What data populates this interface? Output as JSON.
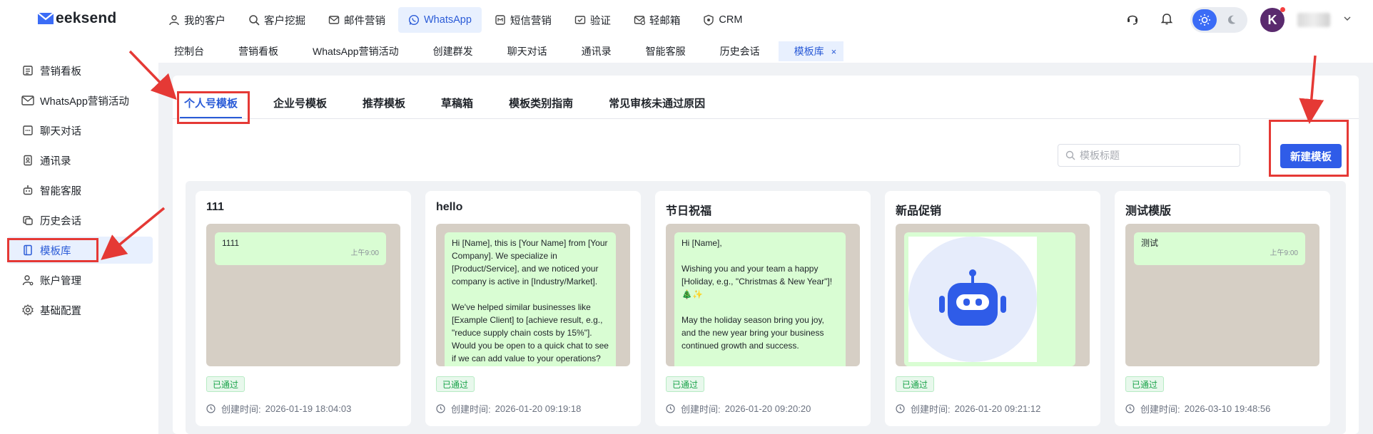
{
  "brand": {
    "logo_text": "eeksend"
  },
  "topnav": [
    {
      "label": "我的客户",
      "icon": "user-icon"
    },
    {
      "label": "客户挖掘",
      "icon": "search-icon"
    },
    {
      "label": "邮件营销",
      "icon": "mail-icon"
    },
    {
      "label": "WhatsApp",
      "icon": "whatsapp-icon",
      "active": true
    },
    {
      "label": "短信营销",
      "icon": "phone-icon"
    },
    {
      "label": "验证",
      "icon": "mail-check-icon"
    },
    {
      "label": "轻邮箱",
      "icon": "mail-light-icon"
    },
    {
      "label": "CRM",
      "icon": "crm-icon"
    }
  ],
  "user": {
    "avatar_letter": "K"
  },
  "subtabs": [
    {
      "label": "控制台"
    },
    {
      "label": "营销看板"
    },
    {
      "label": "WhatsApp营销活动"
    },
    {
      "label": "创建群发"
    },
    {
      "label": "聊天对话"
    },
    {
      "label": "通讯录"
    },
    {
      "label": "智能客服"
    },
    {
      "label": "历史会话"
    },
    {
      "label": "模板库",
      "active": true,
      "close": "×"
    }
  ],
  "sidebar": [
    {
      "label": "营销看板",
      "icon": "dashboard-icon"
    },
    {
      "label": "WhatsApp营销活动",
      "icon": "campaign-icon"
    },
    {
      "label": "聊天对话",
      "icon": "chat-icon"
    },
    {
      "label": "通讯录",
      "icon": "contacts-icon"
    },
    {
      "label": "智能客服",
      "icon": "robot-icon"
    },
    {
      "label": "历史会话",
      "icon": "history-icon"
    },
    {
      "label": "模板库",
      "icon": "template-icon",
      "active": true
    },
    {
      "label": "账户管理",
      "icon": "account-icon"
    },
    {
      "label": "基础配置",
      "icon": "settings-icon"
    }
  ],
  "tabs": [
    {
      "label": "个人号模板",
      "active": true
    },
    {
      "label": "企业号模板"
    },
    {
      "label": "推荐模板"
    },
    {
      "label": "草稿箱"
    },
    {
      "label": "模板类别指南"
    },
    {
      "label": "常见审核未通过原因"
    }
  ],
  "search": {
    "placeholder": "模板标题"
  },
  "new_button": {
    "label": "新建模板"
  },
  "created_label": "创建时间:",
  "cards": [
    {
      "title": "111",
      "message": "1111",
      "time": "上午9:00",
      "status": "已通过",
      "created": "2026-01-19 18:04:03"
    },
    {
      "title": "hello",
      "message": "Hi [Name], this is [Your Name] from [Your Company]. We specialize in [Product/Service], and we noticed your company is active in [Industry/Market].\n\nWe've helped similar businesses like [Example Client] to [achieve result, e.g., \"reduce supply chain costs by 15%\"]. Would you be open to a quick chat to see if we can add value to your operations?",
      "status": "已通过",
      "created": "2026-01-20 09:19:18"
    },
    {
      "title": "节日祝福",
      "message": "Hi [Name],\n\nWishing you and your team a happy [Holiday, e.g., \"Christmas & New Year\"]! 🎄✨\n\nMay the holiday season bring you joy, and the new year bring your business continued growth and success.\n\nIf you're planning for [next quarter/year],",
      "status": "已通过",
      "created": "2026-01-20 09:20:20"
    },
    {
      "title": "新品促销",
      "image": "robot-image",
      "status": "已通过",
      "created": "2026-01-20 09:21:12"
    },
    {
      "title": "测试模版",
      "message": "测试",
      "time": "上午9:00",
      "status": "已通过",
      "created": "2026-03-10 19:48:56"
    }
  ],
  "colors": {
    "accent": "#2a5bd7",
    "button": "#2f5ce8",
    "annotation": "#e53935",
    "bubble": "#d9fdd3",
    "status_green": "#1aa34a"
  }
}
